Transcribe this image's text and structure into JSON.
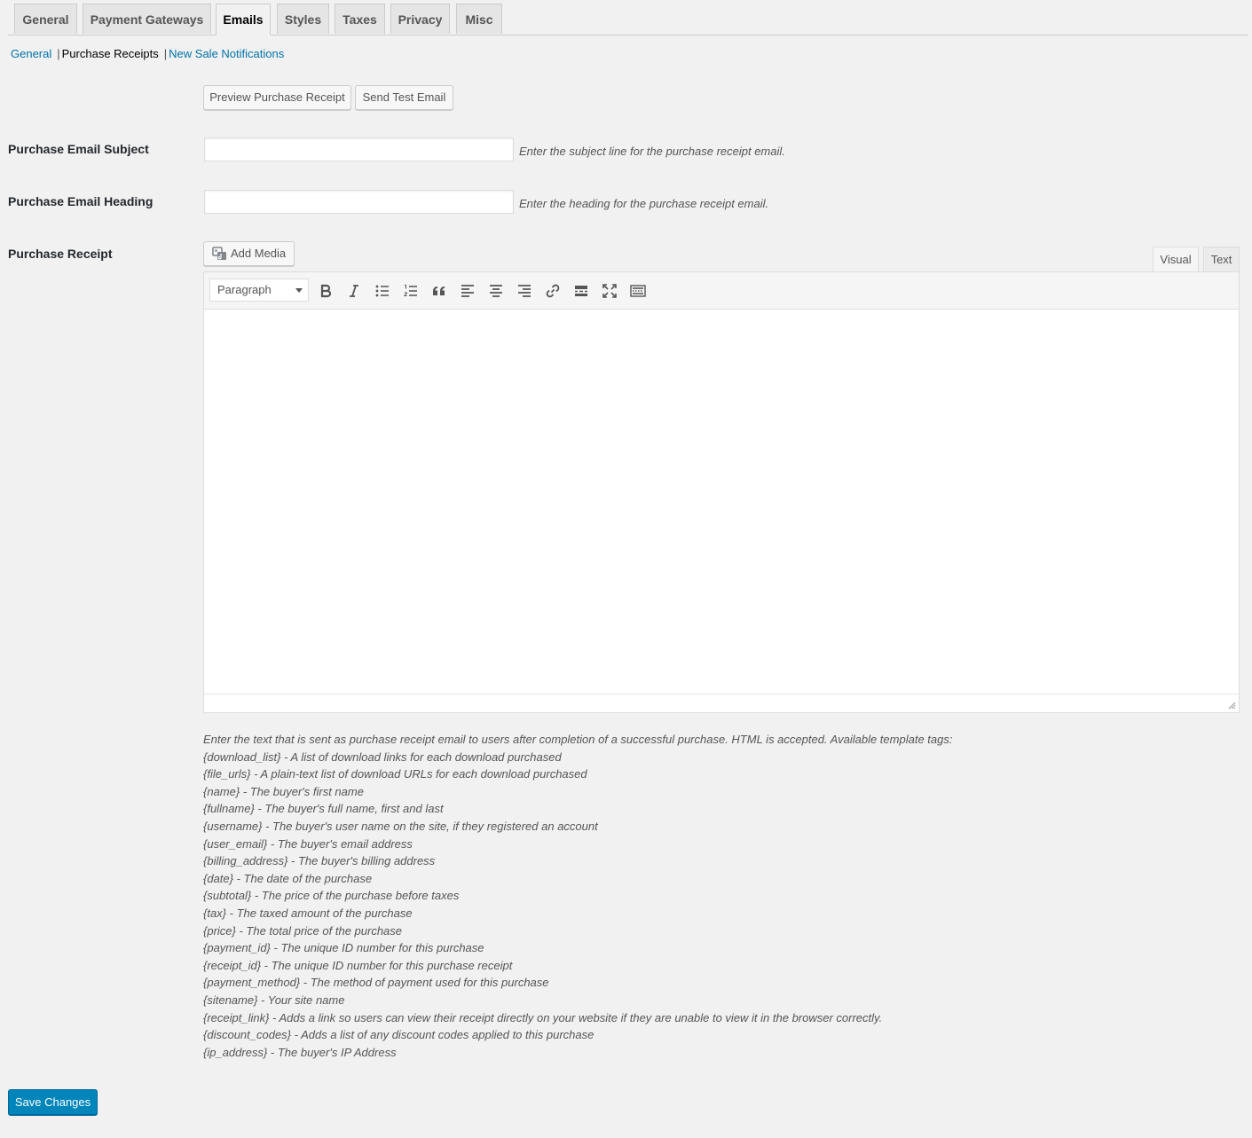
{
  "nav_tabs": [
    {
      "label": "General"
    },
    {
      "label": "Payment Gateways"
    },
    {
      "label": "Emails",
      "active": true
    },
    {
      "label": "Styles"
    },
    {
      "label": "Taxes"
    },
    {
      "label": "Privacy"
    },
    {
      "label": "Misc"
    }
  ],
  "subnav": {
    "general": "General",
    "separator": "|",
    "purchase_receipts": "Purchase Receipts",
    "new_sale_notifications": "New Sale Notifications"
  },
  "actions": {
    "preview": "Preview Purchase Receipt",
    "send_test": "Send Test Email"
  },
  "fields": {
    "subject": {
      "label": "Purchase Email Subject",
      "value": "",
      "hint": "Enter the subject line for the purchase receipt email."
    },
    "heading": {
      "label": "Purchase Email Heading",
      "value": "",
      "hint": "Enter the heading for the purchase receipt email."
    },
    "receipt": {
      "label": "Purchase Receipt"
    }
  },
  "editor": {
    "add_media": "Add Media",
    "tab_visual": "Visual",
    "tab_text": "Text",
    "format": "Paragraph",
    "toolbar_icons": [
      "bold-icon",
      "italic-icon",
      "bullet-list-icon",
      "numbered-list-icon",
      "blockquote-icon",
      "align-left-icon",
      "align-center-icon",
      "align-right-icon",
      "link-icon",
      "read-more-icon",
      "fullscreen-icon",
      "toolbar-toggle-icon"
    ]
  },
  "description": {
    "intro": "Enter the text that is sent as purchase receipt email to users after completion of a successful purchase. HTML is accepted. Available template tags:",
    "tags": [
      "{download_list} - A list of download links for each download purchased",
      "{file_urls} - A plain-text list of download URLs for each download purchased",
      "{name} - The buyer's first name",
      "{fullname} - The buyer's full name, first and last",
      "{username} - The buyer's user name on the site, if they registered an account",
      "{user_email} - The buyer's email address",
      "{billing_address} - The buyer's billing address",
      "{date} - The date of the purchase",
      "{subtotal} - The price of the purchase before taxes",
      "{tax} - The taxed amount of the purchase",
      "{price} - The total price of the purchase",
      "{payment_id} - The unique ID number for this purchase",
      "{receipt_id} - The unique ID number for this purchase receipt",
      "{payment_method} - The method of payment used for this purchase",
      "{sitename} - Your site name",
      "{receipt_link} - Adds a link so users can view their receipt directly on your website if they are unable to view it in the browser correctly.",
      "{discount_codes} - Adds a list of any discount codes applied to this purchase",
      "{ip_address} - The buyer's IP Address"
    ]
  },
  "save_label": "Save Changes",
  "colors": {
    "link": "#0073aa",
    "primary": "#0085ba",
    "background": "#f1f1f1"
  }
}
